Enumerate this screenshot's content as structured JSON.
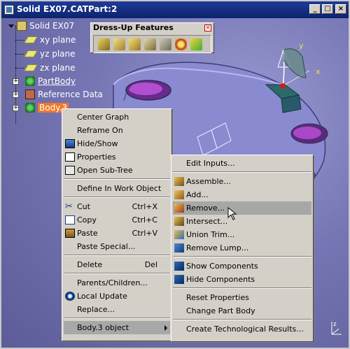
{
  "window": {
    "title": "Solid EX07.CATPart:2",
    "controls": [
      "_",
      "□",
      "×"
    ]
  },
  "tree": {
    "root": "Solid EX07",
    "items": [
      {
        "label": "xy plane",
        "icon": "plane-icon"
      },
      {
        "label": "yz plane",
        "icon": "plane-icon"
      },
      {
        "label": "zx plane",
        "icon": "plane-icon"
      },
      {
        "label": "PartBody",
        "icon": "partbody-icon"
      },
      {
        "label": "Reference Data",
        "icon": "reference-data-icon"
      },
      {
        "label": "Body.3",
        "icon": "body-icon",
        "selected": true
      }
    ]
  },
  "toolbar": {
    "title": "Dress-Up Features",
    "close": "×",
    "icons": [
      "fillet-icon",
      "chamfer-icon",
      "draft-icon",
      "shell-icon",
      "thickness-icon",
      "thread-icon",
      "remove-face-icon"
    ]
  },
  "context_menu": {
    "items": [
      {
        "label": "Center Graph",
        "shortcut": ""
      },
      {
        "label": "Reframe On",
        "shortcut": ""
      },
      {
        "label": "Hide/Show",
        "shortcut": "",
        "icon": "hide-show-icon"
      },
      {
        "label": "Properties",
        "shortcut": "",
        "icon": "properties-icon"
      },
      {
        "label": "Open Sub-Tree",
        "shortcut": "",
        "icon": "open-subtree-icon"
      },
      {
        "label": "Define In Work Object",
        "shortcut": ""
      },
      {
        "label": "Cut",
        "shortcut": "Ctrl+X",
        "icon": "scissors-icon"
      },
      {
        "label": "Copy",
        "shortcut": "Ctrl+C",
        "icon": "copy-icon"
      },
      {
        "label": "Paste",
        "shortcut": "Ctrl+V",
        "icon": "paste-icon"
      },
      {
        "label": "Paste Special...",
        "shortcut": ""
      },
      {
        "label": "Delete",
        "shortcut": "Del"
      },
      {
        "label": "Parents/Children...",
        "shortcut": ""
      },
      {
        "label": "Local Update",
        "shortcut": "",
        "icon": "local-update-icon"
      },
      {
        "label": "Replace...",
        "shortcut": ""
      },
      {
        "label": "Body.3 object",
        "shortcut": "",
        "submenu": true
      }
    ]
  },
  "submenu": {
    "items": [
      {
        "label": "Edit Inputs...",
        "icon": ""
      },
      {
        "label": "Assemble...",
        "icon": "assemble-icon"
      },
      {
        "label": "Add...",
        "icon": "add-icon"
      },
      {
        "label": "Remove...",
        "icon": "remove-icon",
        "highlighted": true
      },
      {
        "label": "Intersect...",
        "icon": "intersect-icon"
      },
      {
        "label": "Union Trim...",
        "icon": "union-trim-icon"
      },
      {
        "label": "Remove Lump...",
        "icon": "remove-lump-icon"
      },
      {
        "label": "Show Components",
        "icon": "show-components-icon"
      },
      {
        "label": "Hide Components",
        "icon": "hide-components-icon"
      },
      {
        "label": "Reset Properties",
        "icon": ""
      },
      {
        "label": "Change Part Body",
        "icon": ""
      },
      {
        "label": "Create Technological Results...",
        "icon": ""
      }
    ]
  },
  "axis": {
    "y": "y",
    "x": "x",
    "z": "z"
  }
}
